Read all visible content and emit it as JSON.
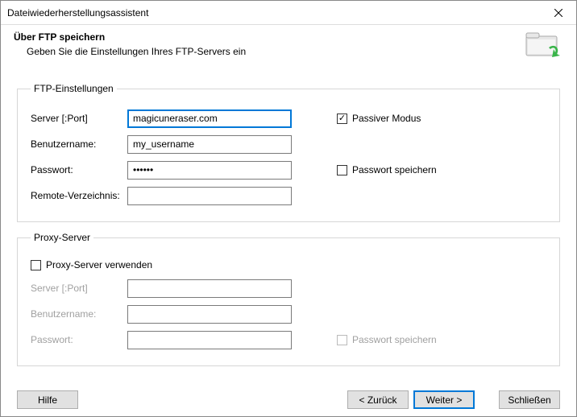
{
  "window": {
    "title": "Dateiwiederherstellungsassistent"
  },
  "header": {
    "title": "Über FTP speichern",
    "subtitle": "Geben Sie die Einstellungen Ihres FTP-Servers ein"
  },
  "ftp": {
    "legend": "FTP-Einstellungen",
    "server_label": "Server [:Port]",
    "server_value": "magicuneraser.com",
    "user_label": "Benutzername:",
    "user_value": "my_username",
    "pass_label": "Passwort:",
    "pass_value": "••••••",
    "remote_label": "Remote-Verzeichnis:",
    "remote_value": "",
    "passive_label": "Passiver Modus",
    "savepass_label": "Passwort speichern"
  },
  "proxy": {
    "legend": "Proxy-Server",
    "use_label": "Proxy-Server verwenden",
    "server_label": "Server [:Port]",
    "server_value": "",
    "user_label": "Benutzername:",
    "user_value": "",
    "pass_label": "Passwort:",
    "pass_value": "",
    "savepass_label": "Passwort speichern"
  },
  "buttons": {
    "help": "Hilfe",
    "back": "< Zurück",
    "next": "Weiter >",
    "close": "Schließen"
  }
}
